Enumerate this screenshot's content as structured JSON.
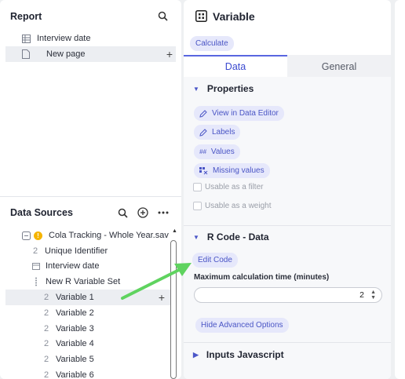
{
  "report": {
    "title": "Report",
    "items": [
      {
        "label": "Interview date",
        "icon": "table-icon"
      },
      {
        "label": "New page",
        "icon": "page-icon",
        "add": "+"
      }
    ]
  },
  "data_sources": {
    "title": "Data Sources",
    "dataset": {
      "label": "Cola Tracking - Whole Year.sav",
      "badge": "!"
    },
    "variables": [
      {
        "num": "2",
        "label": "Unique Identifier",
        "icon": ""
      },
      {
        "num": "",
        "label": "Interview date",
        "icon": "calendar-icon"
      },
      {
        "num": "",
        "label": "New R Variable Set",
        "icon": "dotted-list-icon"
      }
    ],
    "set_items": [
      {
        "num": "2",
        "label": "Variable 1",
        "add": "+"
      },
      {
        "num": "2",
        "label": "Variable 2"
      },
      {
        "num": "2",
        "label": "Variable 3"
      },
      {
        "num": "2",
        "label": "Variable 4"
      },
      {
        "num": "2",
        "label": "Variable 5"
      },
      {
        "num": "2",
        "label": "Variable 6"
      }
    ]
  },
  "right": {
    "title": "Variable",
    "calculate": "Calculate",
    "tabs": [
      "Data",
      "General"
    ],
    "properties": {
      "title": "Properties",
      "buttons": [
        "View in Data Editor",
        "Labels",
        "Values",
        "Missing values"
      ],
      "checkboxes": [
        "Usable as a filter",
        "Usable as a weight"
      ]
    },
    "rcode": {
      "title": "R Code - Data",
      "edit": "Edit Code",
      "max_label": "Maximum calculation time (minutes)",
      "max_value": "2",
      "hide_adv": "Hide Advanced Options"
    },
    "inputs": {
      "title": "Inputs Javascript"
    }
  },
  "colors": {
    "accent": "#4a55c5",
    "chip_bg": "#e6e8fb",
    "warning": "#f5b400",
    "arrow": "#5fd35f"
  }
}
